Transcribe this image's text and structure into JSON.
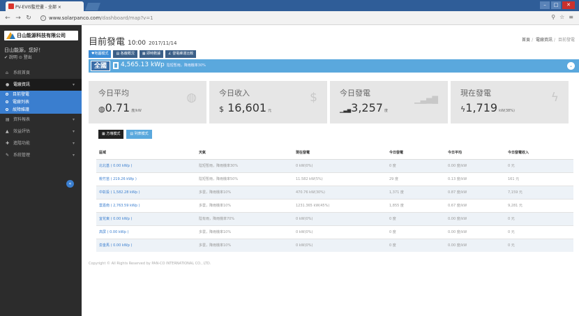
{
  "browser": {
    "tab_title": "PV-EVIS監控畫 - 全部 ×",
    "url_host": "www.solarpanco.com",
    "url_path": "/dashboard/map?v=1"
  },
  "sidebar": {
    "logo_text": "日山能源科技有限公司",
    "greeting": "日山能源，您好！",
    "user_links": "✔ 說明 ⊙ 登出",
    "items": [
      {
        "icon": "⌂",
        "label": "系統首頁"
      },
      {
        "icon": "●",
        "label": "電廠資訊"
      },
      {
        "icon": "▤",
        "label": "資料報表"
      },
      {
        "icon": "▲",
        "label": "效益評估"
      },
      {
        "icon": "✚",
        "label": "進階功能"
      },
      {
        "icon": "✎",
        "label": "系統管理"
      }
    ],
    "subitems": [
      "目前發電",
      "電廠列表",
      "故障維護"
    ]
  },
  "header": {
    "title": "目前發電",
    "time": "10:00",
    "date": "2017/11/14",
    "breadcrumb": [
      "首頁",
      "電廠資訊",
      "目前發電"
    ]
  },
  "mode_buttons": [
    "♥地圖模式",
    "▤ 各廠概況",
    "▦ 即時數據",
    "∠ 發電維運比較"
  ],
  "summary": {
    "region": "全國",
    "power": "4,565.13 kWp",
    "weather": "陰短暫雨，降雨機率30%"
  },
  "cards": [
    {
      "title": "今日平均",
      "prefix": "◍",
      "value": "0.71",
      "unit": "度/kW",
      "icon": "◍"
    },
    {
      "title": "今日收入",
      "prefix": "$",
      "value": "16,601",
      "unit": "元",
      "icon": "$"
    },
    {
      "title": "今日發電",
      "prefix": "▁▃▅",
      "value": "3,257",
      "unit": "度",
      "icon": "▁▃▅▇"
    },
    {
      "title": "現在發電",
      "prefix": "ϟ",
      "value": "1,719",
      "unit": "kW(38%)",
      "icon": "ϟ"
    }
  ],
  "view_buttons": [
    "▦ 方塊模式",
    "▤ 列表模式"
  ],
  "table": {
    "headers": [
      "區域",
      "天氣",
      "現在發電",
      "今日發電",
      "今日平均",
      "今日發電收入"
    ],
    "rows": [
      [
        "北北基 ( 0.00 kWp )",
        "陰短暫雨，降雨機率30%",
        "0 kW(0%)",
        "0 度",
        "0.00 度/kW",
        "0 元"
      ],
      [
        "桃竹苗 ( 219.26 kWp )",
        "陰短暫雨，降雨機率50%",
        "11.582 kW(5%)",
        "29 度",
        "0.13 度/kW",
        "161 元"
      ],
      [
        "中彰投 ( 1,582.28 kWp )",
        "多雲，降雨機率10%",
        "470.76 kW(30%)",
        "1,371 度",
        "0.87 度/kW",
        "7,159 元"
      ],
      [
        "雲嘉南 ( 2,763.59 kWp )",
        "多雲，降雨機率10%",
        "1231.365 kW(45%)",
        "1,855 度",
        "0.67 度/kW",
        "9,281 元"
      ],
      [
        "宜花東 ( 0.00 kWp )",
        "陰有雨，降雨機率70%",
        "0 kW(0%)",
        "0 度",
        "0.00 度/kW",
        "0 元"
      ],
      [
        "高屏 ( 0.00 kWp )",
        "多雲，降雨機率10%",
        "0 kW(0%)",
        "0 度",
        "0.00 度/kW",
        "0 元"
      ],
      [
        "澎金馬 ( 0.00 kWp )",
        "多雲，降雨機率10%",
        "0 kW(0%)",
        "0 度",
        "0.00 度/kW",
        "0 元"
      ]
    ]
  },
  "footer": "Copyright © All Rights Reserved by PAN-CO INTERNATIONAL CO., LTD."
}
